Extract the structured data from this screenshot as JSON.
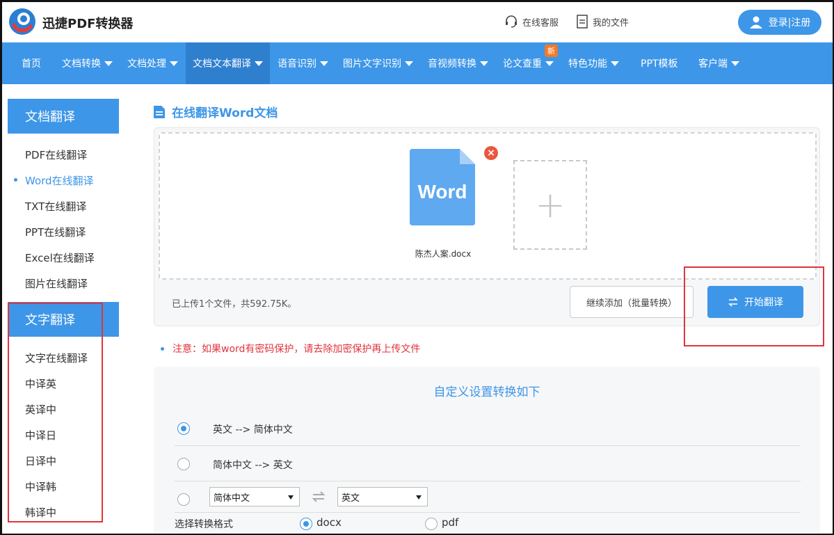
{
  "header": {
    "app_title": "迅捷PDF转换器",
    "service_label": "在线客服",
    "files_label": "我的文件",
    "login_label": "登录|注册"
  },
  "nav": {
    "items": [
      {
        "label": "首页",
        "caret": false
      },
      {
        "label": "文档转换",
        "caret": true
      },
      {
        "label": "文档处理",
        "caret": true
      },
      {
        "label": "文档文本翻译",
        "caret": true,
        "active": true
      },
      {
        "label": "语音识别",
        "caret": true
      },
      {
        "label": "图片文字识别",
        "caret": true
      },
      {
        "label": "音视频转换",
        "caret": true
      },
      {
        "label": "论文查重",
        "caret": true,
        "badge": "新"
      },
      {
        "label": "特色功能",
        "caret": true
      },
      {
        "label": "PPT模板",
        "caret": false
      },
      {
        "label": "客户端",
        "caret": true
      }
    ]
  },
  "sidebar": {
    "doc_section_title": "文档翻译",
    "doc_items": [
      "PDF在线翻译",
      "Word在线翻译",
      "TXT在线翻译",
      "PPT在线翻译",
      "Excel在线翻译",
      "图片在线翻译"
    ],
    "doc_active_index": 1,
    "text_section_title": "文字翻译",
    "text_items": [
      "文字在线翻译",
      "中译英",
      "英译中",
      "中译日",
      "日译中",
      "中译韩",
      "韩译中"
    ]
  },
  "main": {
    "title": "在线翻译Word文档",
    "file_icon_text": "Word",
    "file_name": "陈杰人案.docx",
    "status_text": "已上传1个文件，共592.75K。",
    "continue_label": "继续添加（批量转换）",
    "start_label": "开始翻译",
    "note": "注意：如果word有密码保护，请去除加密保护再上传文件"
  },
  "settings": {
    "title": "自定义设置转换如下",
    "option1": "英文 --> 简体中文",
    "option2": "简体中文 --> 英文",
    "selected_option": 1,
    "source_lang": "简体中文",
    "target_lang": "英文",
    "format_label": "选择转换格式",
    "format_docx": "docx",
    "format_pdf": "pdf",
    "selected_format": "docx"
  },
  "colors": {
    "accent": "#3d96e8",
    "nav_active": "#2f7fcf",
    "highlight_red": "#e0333c",
    "badge_orange": "#f07a2c"
  }
}
